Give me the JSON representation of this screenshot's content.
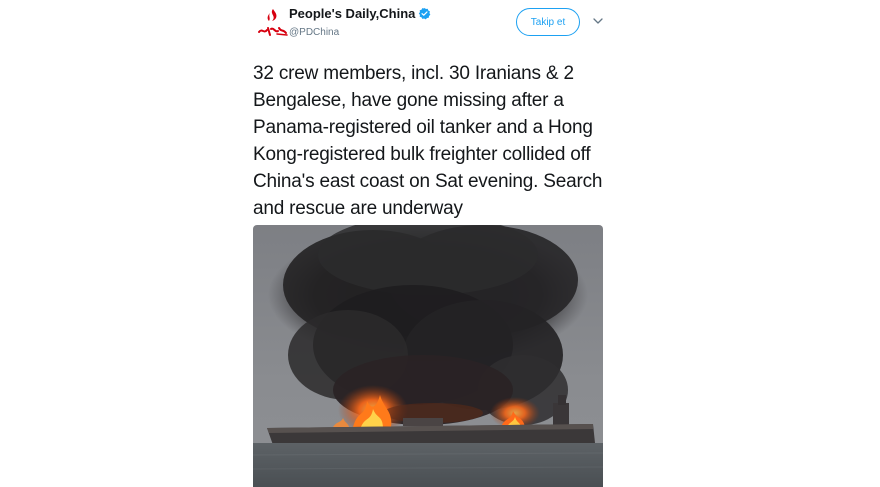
{
  "tweet": {
    "display_name": "People's Daily,China",
    "handle": "@PDChina",
    "follow_label": "Takip et",
    "text": "32 crew members, incl. 30 Iranians & 2 Bengalese, have gone missing after a Panama-registered oil tanker and a Hong Kong-registered bulk freighter collided off China's east coast on Sat evening. Search and rescue are underway",
    "avatar_logo_text": "人民日报",
    "icons": {
      "verified": "verified-badge-icon",
      "caret": "chevron-down-icon"
    },
    "colors": {
      "accent": "#1da1f2",
      "secondary_text": "#657786",
      "avatar_logo": "#d7000f"
    }
  }
}
